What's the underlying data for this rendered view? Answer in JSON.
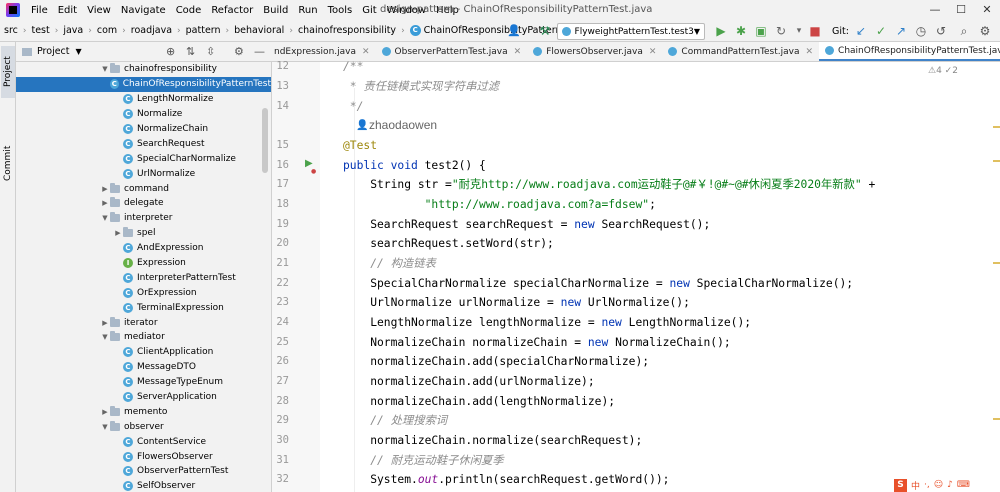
{
  "menubar": {
    "items": [
      "File",
      "Edit",
      "View",
      "Navigate",
      "Code",
      "Refactor",
      "Build",
      "Run",
      "Tools",
      "Git",
      "Window",
      "Help"
    ],
    "title": "design-pattern - ChainOfResponsibilityPatternTest.java"
  },
  "breadcrumb": [
    "src",
    "test",
    "java",
    "com",
    "roadjava",
    "pattern",
    "behavioral",
    "chainofresponsibility",
    "ChainOfResponsibilityPatternTest"
  ],
  "toolbar": {
    "run_config": "FlyweightPatternTest.test3",
    "git_label": "Git:"
  },
  "project_panel": {
    "title": "Project",
    "vtab_project": "Project",
    "vtab_commit": "Commit",
    "tree": [
      {
        "label": "chainofresponsibility",
        "type": "folder",
        "level": 1,
        "expanded": true
      },
      {
        "label": "ChainOfResponsibilityPatternTest",
        "type": "class",
        "level": 2,
        "selected": true
      },
      {
        "label": "LengthNormalize",
        "type": "class",
        "level": 2
      },
      {
        "label": "Normalize",
        "type": "class",
        "level": 2
      },
      {
        "label": "NormalizeChain",
        "type": "class",
        "level": 2
      },
      {
        "label": "SearchRequest",
        "type": "class",
        "level": 2
      },
      {
        "label": "SpecialCharNormalize",
        "type": "class",
        "level": 2
      },
      {
        "label": "UrlNormalize",
        "type": "class",
        "level": 2
      },
      {
        "label": "command",
        "type": "folder",
        "level": 1,
        "expanded": false
      },
      {
        "label": "delegate",
        "type": "folder",
        "level": 1,
        "expanded": false
      },
      {
        "label": "interpreter",
        "type": "folder",
        "level": 1,
        "expanded": true
      },
      {
        "label": "spel",
        "type": "folder",
        "level": 2,
        "expanded": false
      },
      {
        "label": "AndExpression",
        "type": "class",
        "level": 2
      },
      {
        "label": "Expression",
        "type": "interface",
        "level": 2
      },
      {
        "label": "InterpreterPatternTest",
        "type": "class",
        "level": 2
      },
      {
        "label": "OrExpression",
        "type": "class",
        "level": 2
      },
      {
        "label": "TerminalExpression",
        "type": "class",
        "level": 2
      },
      {
        "label": "iterator",
        "type": "folder",
        "level": 1,
        "expanded": false
      },
      {
        "label": "mediator",
        "type": "folder",
        "level": 1,
        "expanded": true
      },
      {
        "label": "ClientApplication",
        "type": "class",
        "level": 2
      },
      {
        "label": "MessageDTO",
        "type": "class",
        "level": 2
      },
      {
        "label": "MessageTypeEnum",
        "type": "class",
        "level": 2
      },
      {
        "label": "ServerApplication",
        "type": "class",
        "level": 2
      },
      {
        "label": "memento",
        "type": "folder",
        "level": 1,
        "expanded": false
      },
      {
        "label": "observer",
        "type": "folder",
        "level": 1,
        "expanded": true
      },
      {
        "label": "ContentService",
        "type": "class",
        "level": 2
      },
      {
        "label": "FlowersObserver",
        "type": "class",
        "level": 2
      },
      {
        "label": "ObserverPatternTest",
        "type": "class",
        "level": 2
      },
      {
        "label": "SelfObserver",
        "type": "class",
        "level": 2
      }
    ]
  },
  "tabs": [
    {
      "label": "ndExpression.java",
      "active": false
    },
    {
      "label": "ObserverPatternTest.java",
      "active": false
    },
    {
      "label": "FlowersObserver.java",
      "active": false
    },
    {
      "label": "CommandPatternTest.java",
      "active": false
    },
    {
      "label": "ChainOfResponsibilityPatternTest.java",
      "active": true
    }
  ],
  "editor": {
    "warnings": "⚠4 ✓2",
    "author": "zhaodaowen",
    "line_numbers": [
      "12",
      "13",
      "14",
      "",
      "15",
      "16",
      "17",
      "18",
      "19",
      "20",
      "21",
      "22",
      "23",
      "24",
      "25",
      "26",
      "27",
      "28",
      "29",
      "30",
      "31",
      "32"
    ]
  }
}
